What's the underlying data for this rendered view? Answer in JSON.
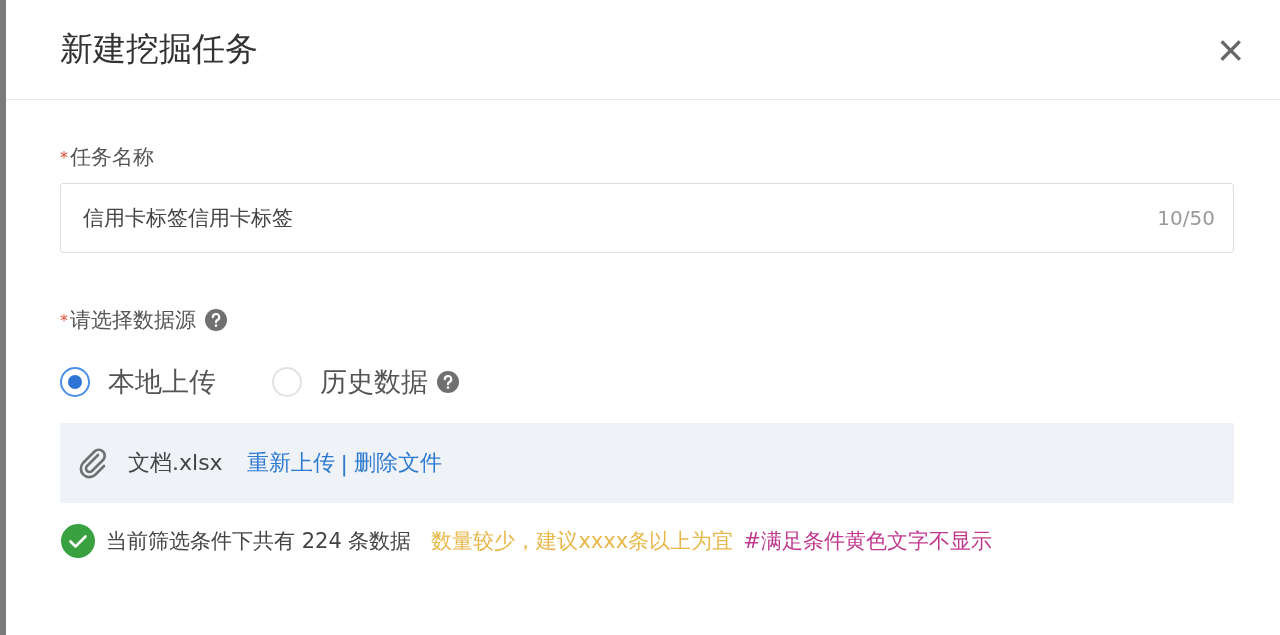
{
  "dialog": {
    "title": "新建挖掘任务",
    "close": "×"
  },
  "fields": [
    {
      "kind": "text",
      "label": "任务名称",
      "required_mark": "*",
      "help": false,
      "value": "信用卡标签信用卡标签",
      "counter": "10/50"
    },
    {
      "kind": "source",
      "label": "请选择数据源",
      "required_mark": "*",
      "help": true,
      "options": [
        {
          "label": "本地上传",
          "selected": true,
          "help": false
        },
        {
          "label": "历史数据",
          "selected": false,
          "help": true
        }
      ],
      "upload": {
        "file": "文档.xlsx",
        "actions": [
          "重新上传",
          "删除文件"
        ],
        "separator": "|"
      }
    }
  ],
  "status": {
    "ok": true,
    "text": "当前筛选条件下共有 224 条数据",
    "hints": [
      {
        "text": "数量较少，建议xxxx条以上为宜",
        "color": "#e8b84a"
      },
      {
        "text": "#满足条件黄色文字不显示",
        "color": "#c0398f"
      }
    ]
  }
}
